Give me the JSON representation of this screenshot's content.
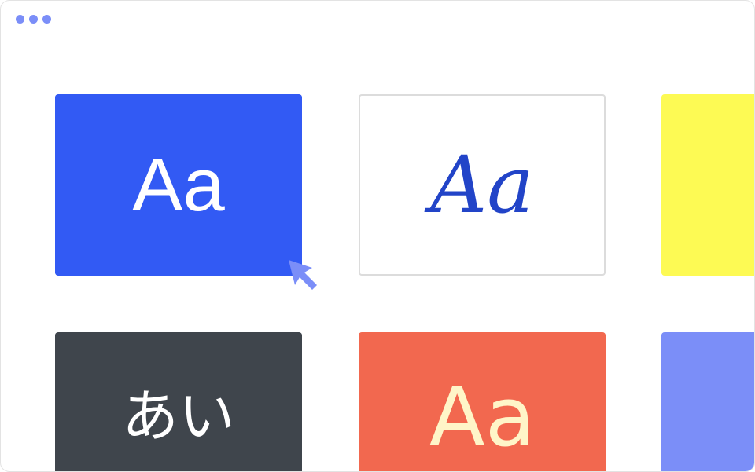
{
  "window": {
    "controls": [
      {
        "icon": "dot-icon"
      },
      {
        "icon": "dot-icon"
      },
      {
        "icon": "dot-icon"
      }
    ]
  },
  "tiles": [
    {
      "label": "Aa",
      "background": "#325af4",
      "text_color": "#ffffff",
      "selected": true
    },
    {
      "label": "Aa",
      "background": "#ffffff",
      "text_color": "#2244c8"
    },
    {
      "label": "",
      "background": "#fdfa54"
    },
    {
      "label": "あい",
      "background": "#3f454c",
      "text_color": "#ffffff"
    },
    {
      "label": "Aa",
      "background": "#f2684f",
      "text_color": "#fff5c8"
    },
    {
      "label": "",
      "background": "#7b8ef8"
    }
  ],
  "cursor": {
    "icon": "pointer-arrow-icon",
    "color": "#7b8ef8"
  }
}
